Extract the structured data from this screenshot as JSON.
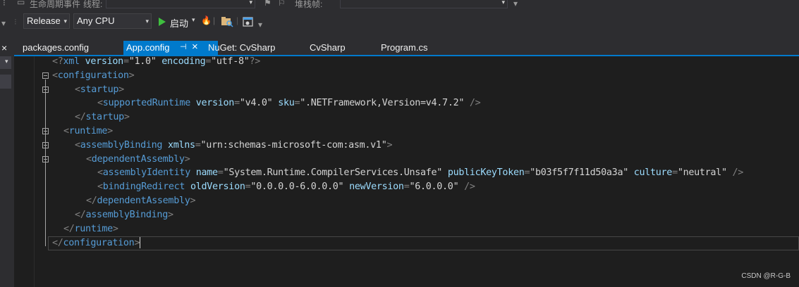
{
  "toolbar_top": {
    "lifecycle_label": "生命周期事件",
    "thread_label": "线程:",
    "stack_label": "堆栈帧:"
  },
  "toolbar": {
    "config_value": "Release",
    "platform_value": "Any CPU",
    "start_label": "启动"
  },
  "tabs": [
    {
      "label": "packages.config"
    },
    {
      "label": "App.config"
    },
    {
      "label": "NuGet: CvSharp"
    },
    {
      "label": "CvSharp"
    },
    {
      "label": "Program.cs"
    }
  ],
  "code": {
    "l1": {
      "open": "<?",
      "tag": "xml",
      "a1": "version",
      "v1": "\"1.0\"",
      "a2": "encoding",
      "v2": "\"utf-8\"",
      "close": "?>"
    },
    "l2": {
      "tag": "configuration"
    },
    "l3": {
      "tag": "startup"
    },
    "l4": {
      "tag": "supportedRuntime",
      "a1": "version",
      "v1": "\"v4.0\"",
      "a2": "sku",
      "v2": "\".NETFramework,Version=v4.7.2\""
    },
    "l5": {
      "tag": "startup"
    },
    "l6": {
      "tag": "runtime"
    },
    "l7": {
      "tag": "assemblyBinding",
      "a1": "xmlns",
      "v1": "\"urn:schemas-microsoft-com:asm.v1\""
    },
    "l8": {
      "tag": "dependentAssembly"
    },
    "l9": {
      "tag": "assemblyIdentity",
      "a1": "name",
      "v1": "\"System.Runtime.CompilerServices.Unsafe\"",
      "a2": "publicKeyToken",
      "v2": "\"b03f5f7f11d50a3a\"",
      "a3": "culture",
      "v3": "\"neutral\""
    },
    "l10": {
      "tag": "bindingRedirect",
      "a1": "oldVersion",
      "v1": "\"0.0.0.0-6.0.0.0\"",
      "a2": "newVersion",
      "v2": "\"6.0.0.0\""
    },
    "l11": {
      "tag": "dependentAssembly"
    },
    "l12": {
      "tag": "assemblyBinding"
    },
    "l13": {
      "tag": "runtime"
    },
    "l14": {
      "tag": "configuration"
    }
  },
  "watermark": "CSDN @R-G-B"
}
